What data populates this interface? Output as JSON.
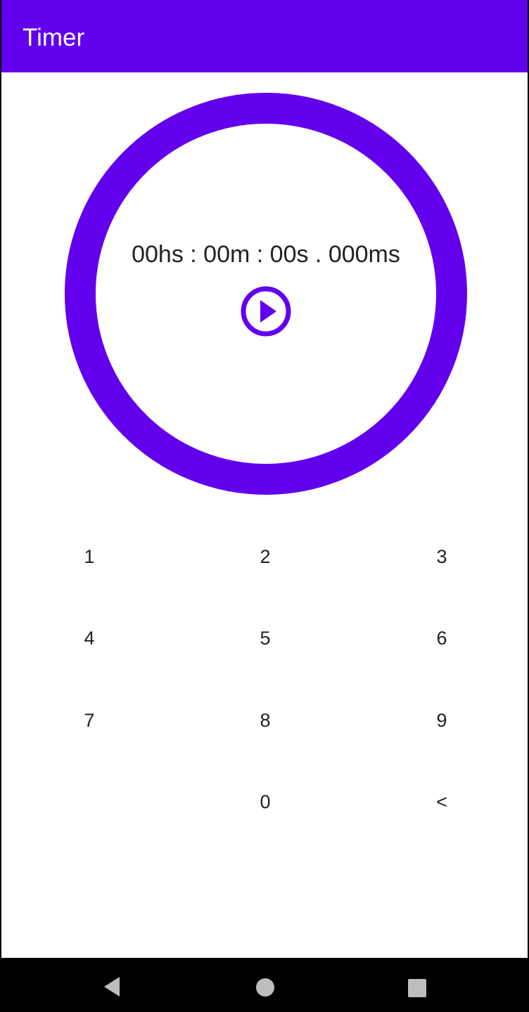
{
  "app_bar": {
    "title": "Timer",
    "color": "#6200ee"
  },
  "timer": {
    "display": "00hs : 00m : 00s . 000ms",
    "ring_color": "#6200ee",
    "play_icon": "play-circle-icon"
  },
  "keypad": {
    "keys": [
      "1",
      "2",
      "3",
      "4",
      "5",
      "6",
      "7",
      "8",
      "9",
      "",
      "0",
      "<"
    ]
  },
  "nav_bar": {
    "back_icon": "back-triangle-icon",
    "home_icon": "home-circle-icon",
    "recents_icon": "recents-square-icon"
  }
}
